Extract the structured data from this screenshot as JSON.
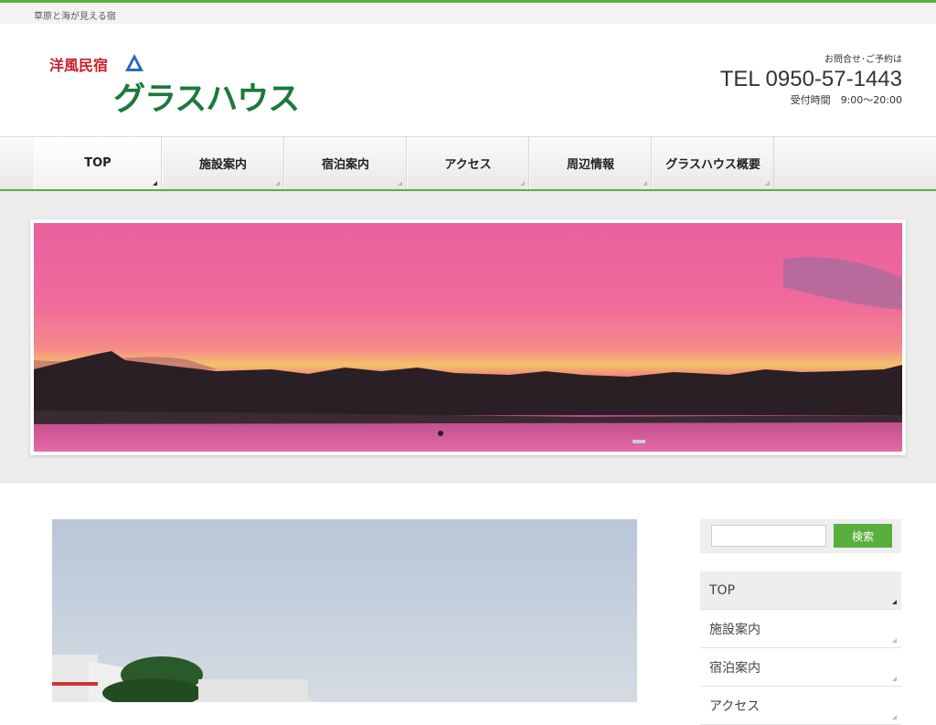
{
  "site": {
    "tagline": "草原と海が見える宿",
    "logo_sub": "洋風民宿",
    "logo_main": "グラスハウス"
  },
  "contact": {
    "ask": "お問合せ･ご予約は",
    "tel": "TEL 0950-57-1443",
    "hours": "受付時間　9:00〜20:00"
  },
  "nav": {
    "items": [
      {
        "label": "TOP"
      },
      {
        "label": "施設案内"
      },
      {
        "label": "宿泊案内"
      },
      {
        "label": "アクセス"
      },
      {
        "label": "周辺情報"
      },
      {
        "label": "グラスハウス概要"
      }
    ]
  },
  "sidebar": {
    "search_button": "検索",
    "menu": [
      {
        "label": "TOP"
      },
      {
        "label": "施設案内"
      },
      {
        "label": "宿泊案内"
      },
      {
        "label": "アクセス"
      }
    ]
  },
  "colors": {
    "accent": "#5aae3e",
    "logo_red": "#c8202a",
    "logo_green": "#1a7a3a"
  }
}
